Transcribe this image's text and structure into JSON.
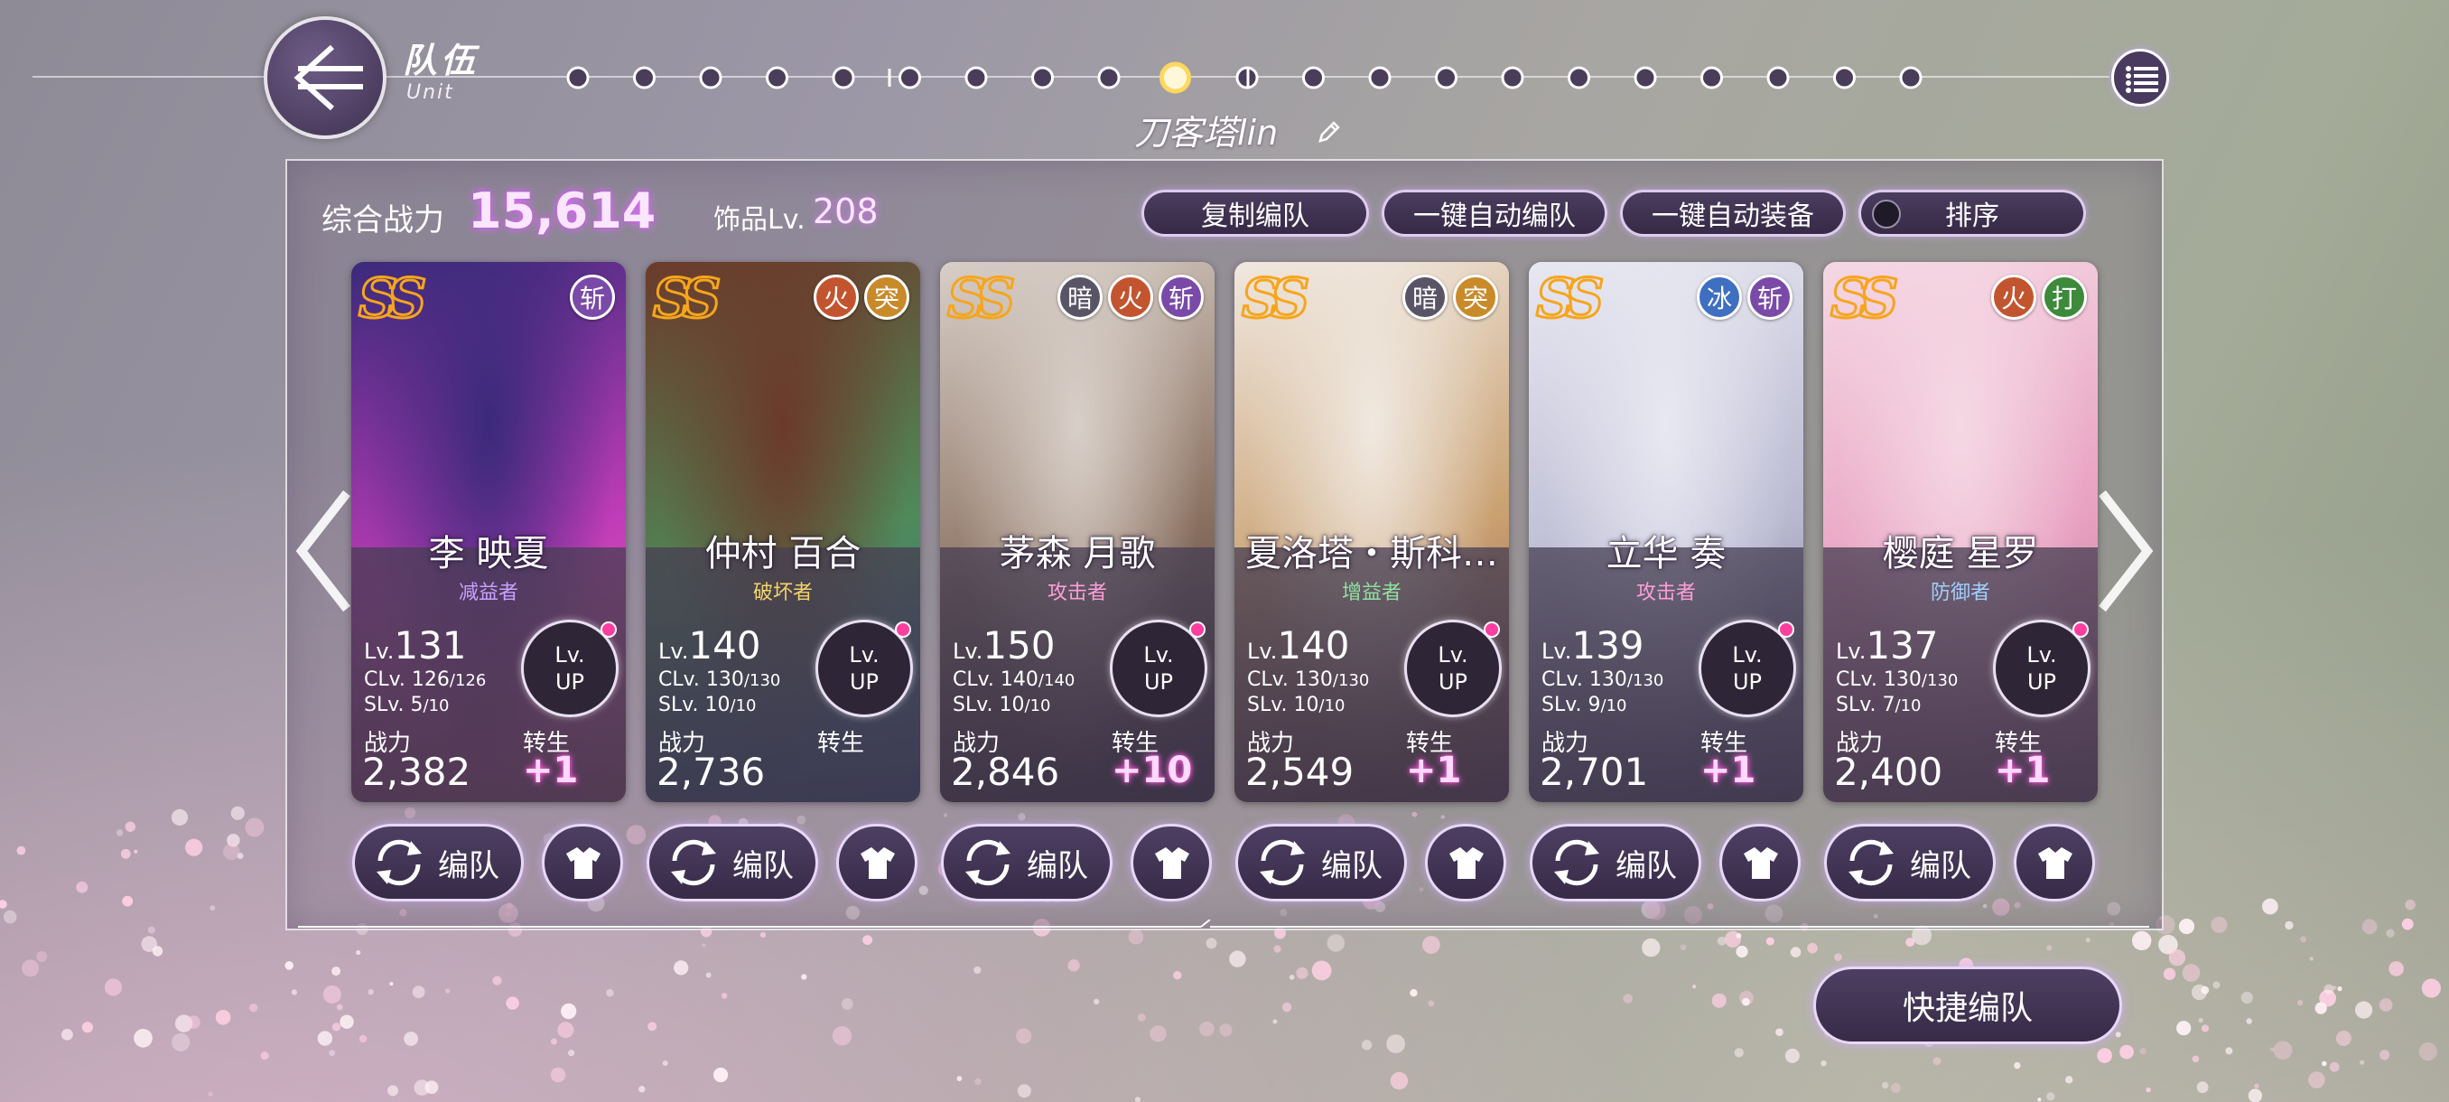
{
  "header": {
    "title": "队伍",
    "subtitle": "Unit",
    "team_name": "刀客塔lin",
    "step_count": 21,
    "active_step": 9
  },
  "summary": {
    "power_label": "综合战力",
    "power_value": "15,614",
    "accessory_label": "饰品Lv.",
    "accessory_value": "208"
  },
  "toolbar": {
    "copy_label": "复制编队",
    "auto_form_label": "一键自动编队",
    "auto_equip_label": "一键自动装备",
    "sort_label": "排序"
  },
  "cards": [
    {
      "rank": "SS",
      "name": "李 映夏",
      "role": "减益者",
      "role_color": "#c9a0ff",
      "badges": [
        {
          "label": "斩",
          "color": "#7a4aa8"
        }
      ],
      "lv_prefix": "Lv.",
      "lv": "131",
      "clv": "CLv. 126",
      "clv_max": "/126",
      "slv": "SLv. 5",
      "slv_max": "/10",
      "power_label": "战力",
      "power": "2,382",
      "rebirth_label": "转生",
      "rebirth": "+1",
      "art": [
        "#3a2a7a",
        "#c03cb8",
        "#f06aa0"
      ]
    },
    {
      "rank": "SS",
      "name": "仲村 百合",
      "role": "破坏者",
      "role_color": "#f4d36b",
      "badges": [
        {
          "label": "火",
          "color": "#c2552f"
        },
        {
          "label": "突",
          "color": "#c98a2a"
        }
      ],
      "lv_prefix": "Lv.",
      "lv": "140",
      "clv": "CLv. 130",
      "clv_max": "/130",
      "slv": "SLv. 10",
      "slv_max": "/10",
      "power_label": "战力",
      "power": "2,736",
      "rebirth_label": "转生",
      "rebirth": "",
      "art": [
        "#6b3a2a",
        "#4f8a5a",
        "#3c6aa8"
      ]
    },
    {
      "rank": "SS",
      "name": "茅森 月歌",
      "role": "攻击者",
      "role_color": "#ff9ed8",
      "badges": [
        {
          "label": "暗",
          "color": "#5a5566"
        },
        {
          "label": "火",
          "color": "#c2552f"
        },
        {
          "label": "斩",
          "color": "#7a4aa8"
        }
      ],
      "lv_prefix": "Lv.",
      "lv": "150",
      "clv": "CLv. 140",
      "clv_max": "/140",
      "slv": "SLv. 10",
      "slv_max": "/10",
      "power_label": "战力",
      "power": "2,846",
      "rebirth_label": "转生",
      "rebirth": "+10",
      "art": [
        "#d8cfc8",
        "#8a7060",
        "#3a3040"
      ]
    },
    {
      "rank": "SS",
      "name": "夏洛塔・斯科…",
      "role": "增益者",
      "role_color": "#8fe0a0",
      "badges": [
        {
          "label": "暗",
          "color": "#5a5566"
        },
        {
          "label": "突",
          "color": "#c98a2a"
        }
      ],
      "lv_prefix": "Lv.",
      "lv": "140",
      "clv": "CLv. 130",
      "clv_max": "/130",
      "slv": "SLv. 10",
      "slv_max": "/10",
      "power_label": "战力",
      "power": "2,549",
      "rebirth_label": "转生",
      "rebirth": "+1",
      "art": [
        "#f0e8e0",
        "#c9a070",
        "#7a4a50"
      ]
    },
    {
      "rank": "SS",
      "name": "立华 奏",
      "role": "攻击者",
      "role_color": "#ff9ed8",
      "badges": [
        {
          "label": "冰",
          "color": "#3e6fc0"
        },
        {
          "label": "斩",
          "color": "#7a4aa8"
        }
      ],
      "lv_prefix": "Lv.",
      "lv": "139",
      "clv": "CLv. 130",
      "clv_max": "/130",
      "slv": "SLv. 9",
      "slv_max": "/10",
      "power_label": "战力",
      "power": "2,701",
      "rebirth_label": "转生",
      "rebirth": "+1",
      "art": [
        "#e8e8f2",
        "#b8b8d0",
        "#6a6a88"
      ]
    },
    {
      "rank": "SS",
      "name": "樱庭 星罗",
      "role": "防御者",
      "role_color": "#9fd0ff",
      "badges": [
        {
          "label": "火",
          "color": "#c2552f"
        },
        {
          "label": "打",
          "color": "#3d8a3a"
        }
      ],
      "lv_prefix": "Lv.",
      "lv": "137",
      "clv": "CLv. 130",
      "clv_max": "/130",
      "slv": "SLv. 7",
      "slv_max": "/10",
      "power_label": "战力",
      "power": "2,400",
      "rebirth_label": "转生",
      "rebirth": "+1",
      "art": [
        "#f5d8e4",
        "#e8a0c0",
        "#b07090"
      ]
    }
  ],
  "lvup_line1": "Lv.",
  "lvup_line2": "UP",
  "form_button_label": "编队",
  "quick_button_label": "快捷编队",
  "icons": {
    "back": "back-arrow-icon",
    "menu": "list-menu-icon",
    "edit": "pencil-icon",
    "swap": "swap-cycle-icon",
    "outfit": "shirt-icon",
    "prev": "chevron-left-icon",
    "next": "chevron-right-icon"
  }
}
